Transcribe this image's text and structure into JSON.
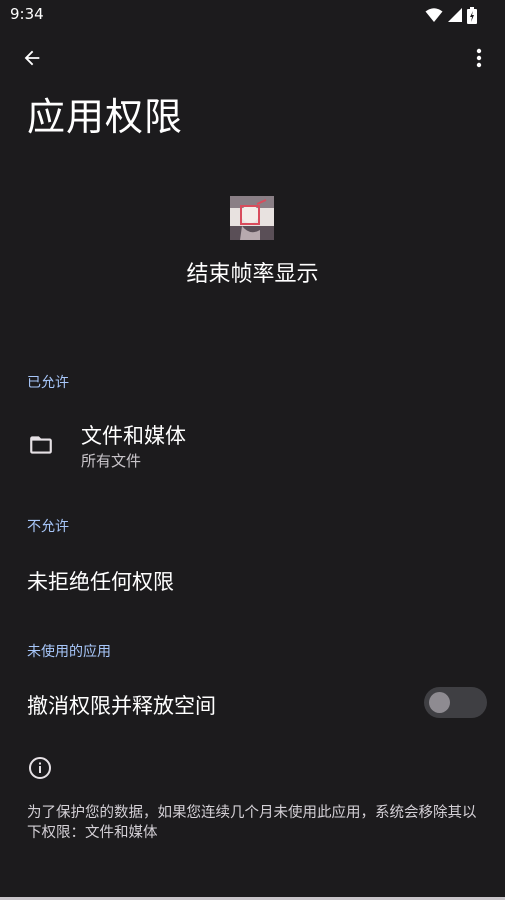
{
  "status": {
    "time": "9:34"
  },
  "header": {
    "title": "应用权限"
  },
  "app": {
    "name": "结束帧率显示"
  },
  "sections": {
    "allowed": "已允许",
    "denied": "不允许",
    "unused": "未使用的应用"
  },
  "allowed_items": [
    {
      "title": "文件和媒体",
      "subtitle": "所有文件",
      "icon": "folder-icon"
    }
  ],
  "denied_empty": "未拒绝任何权限",
  "unused_toggle": {
    "label": "撤消权限并释放空间",
    "checked": false
  },
  "footer": {
    "text": "为了保护您的数据，如果您连续几个月未使用此应用，系统会移除其以下权限：文件和媒体"
  },
  "colors": {
    "background": "#1c1b1d",
    "section_header": "#a8c7fa",
    "text_primary": "#ffffff"
  }
}
